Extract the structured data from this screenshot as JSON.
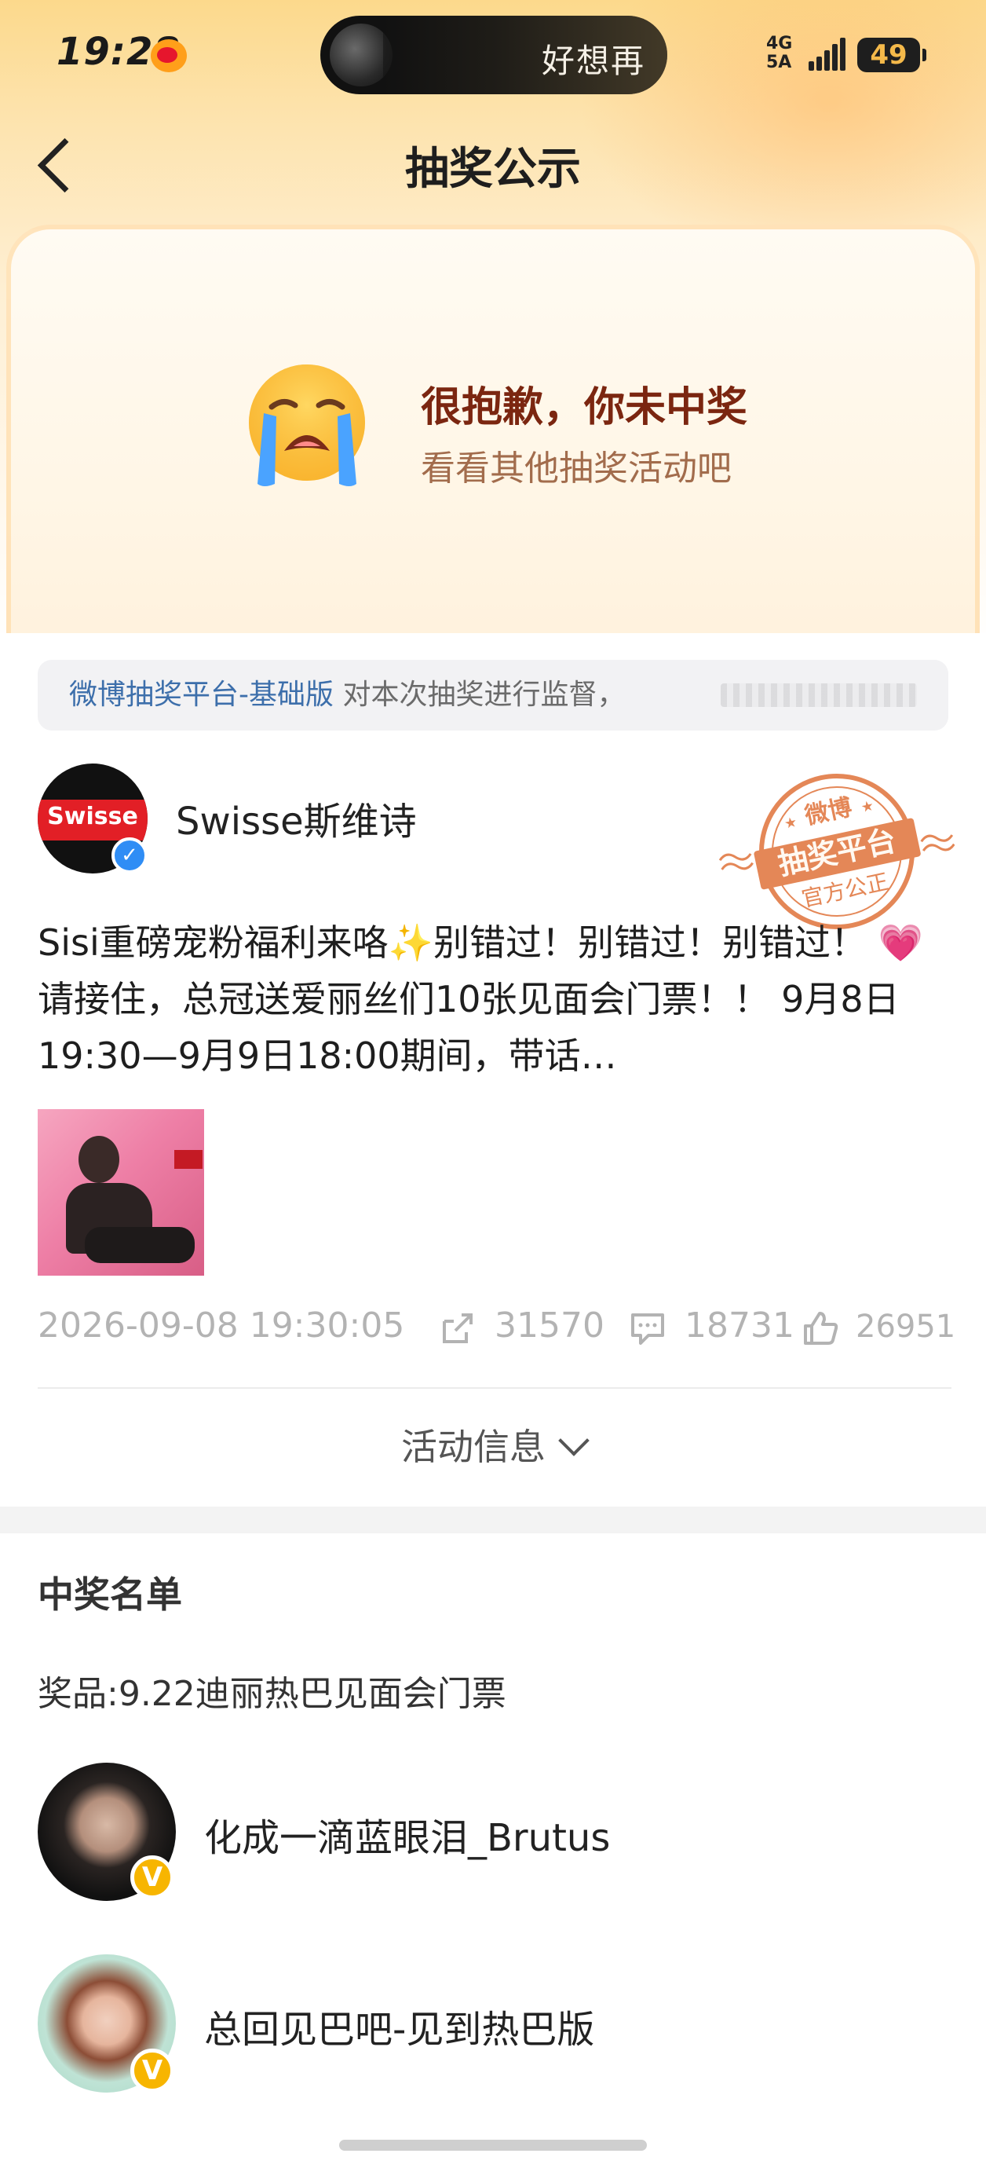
{
  "status_bar": {
    "time": "19:28",
    "network": "4G",
    "network2": "5A",
    "battery": "49",
    "island_text": "好想再"
  },
  "nav": {
    "title": "抽奖公示"
  },
  "result": {
    "title": "很抱歉，你未中奖",
    "subtitle": "看看其他抽奖活动吧"
  },
  "supervise": {
    "link": "微博抽奖平台-基础版",
    "text": " 对本次抽奖进行监督，"
  },
  "post": {
    "author": "Swisse斯维诗",
    "avatar_text": "Swisse",
    "stamp_top": "微博",
    "stamp_main": "抽奖平台",
    "stamp_bottom": "官方公正",
    "text": "Sisi重磅宠粉福利来咯✨别错过！别错过！别错过！ 💗请接住，总冠送爱丽丝们10张见面会门票！！ 9月8日19:30—9月9日18:00期间，带话…",
    "time": "2026-09-08 19:30:05",
    "reposts": "31570",
    "comments": "18731",
    "likes": "26951"
  },
  "activity_info": {
    "label": "活动信息"
  },
  "winners": {
    "title": "中奖名单",
    "prize": "奖品:9.22迪丽热巴见面会门票",
    "list": [
      {
        "name": "化成一滴蓝眼泪_Brutus",
        "badge": "V"
      },
      {
        "name": "总回见巴吧-见到热巴版",
        "badge": "V"
      }
    ]
  },
  "colors": {
    "accent_link": "#3d6fab",
    "result_title": "#7b2610",
    "stamp": "#e0733a",
    "verified_blue": "#2f8df5",
    "verified_gold": "#f7b500"
  }
}
